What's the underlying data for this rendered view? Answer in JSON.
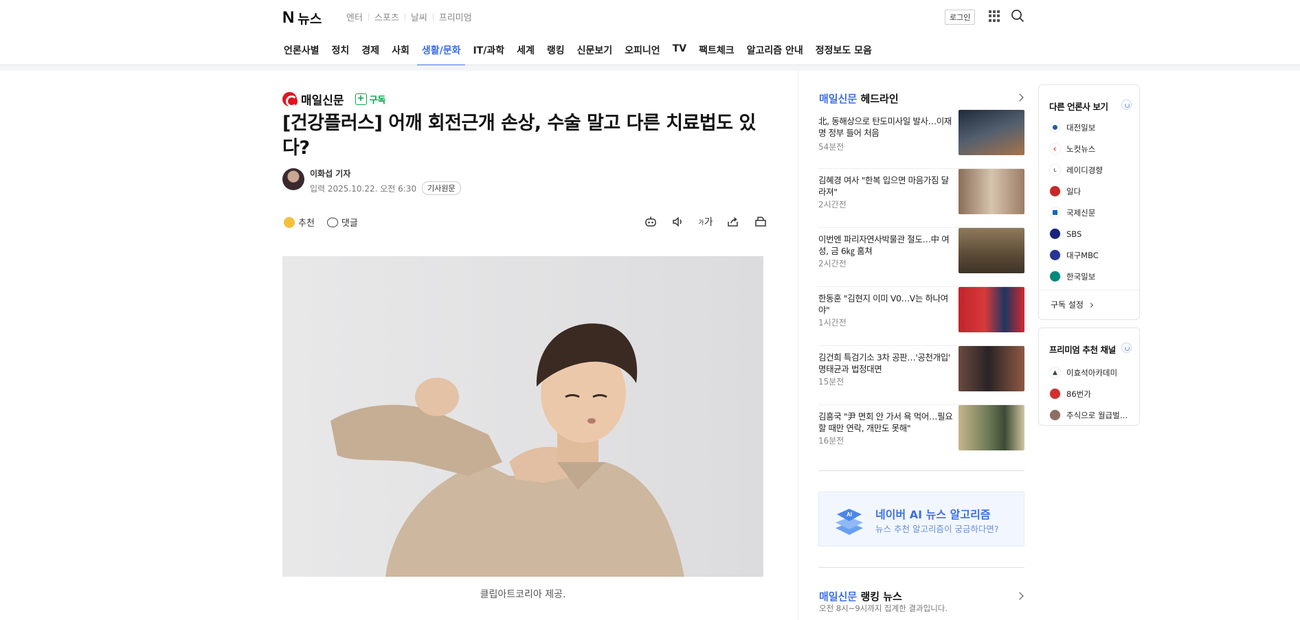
{
  "header": {
    "logo_mark": "N",
    "logo_text": "뉴스",
    "services": [
      "엔터",
      "스포츠",
      "날씨",
      "프리미엄"
    ],
    "login_label": "로그인"
  },
  "gnb": {
    "items": [
      "언론사별",
      "정치",
      "경제",
      "사회",
      "생활/문화",
      "IT/과학",
      "세계",
      "랭킹",
      "신문보기",
      "오피니언",
      "TV",
      "팩트체크",
      "알고리즘 안내",
      "정정보도 모음"
    ],
    "active": "생활/문화"
  },
  "article": {
    "press_name": "매일신문",
    "subscribe_label": "구독",
    "title": "[건강플러스] 어깨 회전근개 손상, 수술 말고 다른 치료법도 있다?",
    "reporter": "이화섭 기자",
    "date_label": "입력 2025.10.22. 오전 6:30",
    "original_label": "기사원문",
    "like_label": "추천",
    "comment_label": "댓글",
    "font_tool_label": "가",
    "caption": "클립아트코리아 제공."
  },
  "headlines": {
    "press": "매일신문",
    "title": "헤드라인",
    "items": [
      {
        "text": "北, 동해상으로 탄도미사일 발사…이재명 정부 들어 처음",
        "time": "54분전",
        "thumb_color": "#2d3d52"
      },
      {
        "text": "김혜경 여사 \"한복 입으면 마음가짐 달라져\"",
        "time": "2시간전",
        "thumb_color": "#b39c84"
      },
      {
        "text": "이번엔 파리자연사박물관 절도…中 여성, 금 6㎏ 훔쳐",
        "time": "2시간전",
        "thumb_color": "#6d5a42"
      },
      {
        "text": "한동훈 \"김현지 이미 V0…V는 하나여야\"",
        "time": "1시간전",
        "thumb_color": "#b9262f"
      },
      {
        "text": "김건희 특검기소 3차 공판…'공천개입' 명태균과 법정대면",
        "time": "15분전",
        "thumb_color": "#5a3e3a"
      },
      {
        "text": "김흥국 \"尹 면회 안 가서 욕 먹어…필요할 때만 연락, 개만도 못해\"",
        "time": "16분전",
        "thumb_color": "#7e8a6a"
      }
    ]
  },
  "ai_banner": {
    "title": "네이버 AI 뉴스 알고리즘",
    "subtitle": "뉴스 추천 알고리즘이 궁금하다면?",
    "cube_label": "AI"
  },
  "ranking": {
    "press": "매일신문",
    "title": "랭킹 뉴스",
    "subtitle": "오전 8시~9시까지 집계한 결과입니다."
  },
  "other_press": {
    "title": "다른 언론사 보기",
    "items": [
      {
        "name": "대전일보",
        "color": "#1f5aa8"
      },
      {
        "name": "노컷뉴스",
        "color": "#e53935"
      },
      {
        "name": "레이디경향",
        "color": "#777777"
      },
      {
        "name": "일다",
        "color": "#c62828"
      },
      {
        "name": "국제신문",
        "color": "#1565c0"
      },
      {
        "name": "SBS",
        "color": "#1a237e"
      },
      {
        "name": "대구MBC",
        "color": "#283593"
      },
      {
        "name": "한국일보",
        "color": "#00897b"
      }
    ],
    "footer_label": "구독 설정"
  },
  "premium": {
    "title": "프리미엄 추천 채널",
    "items": [
      {
        "name": "이효석아카데미",
        "color": "#37474f"
      },
      {
        "name": "86번가",
        "color": "#d32f2f"
      },
      {
        "name": "주식으로 월급벌…",
        "color": "#8d6e63"
      }
    ]
  },
  "colors": {
    "accent": "#3c6ee6",
    "subscribe": "#03a64b"
  }
}
